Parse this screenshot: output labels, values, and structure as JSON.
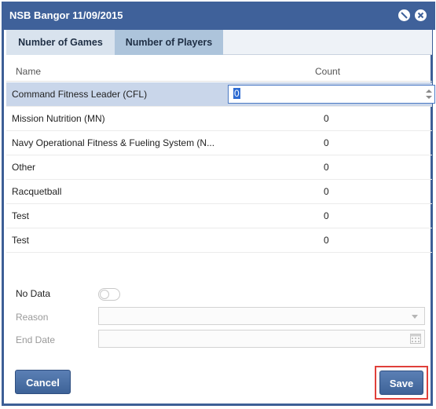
{
  "dialog": {
    "title": "NSB Bangor 11/09/2015"
  },
  "tabs": [
    {
      "label": "Number of Games",
      "active": false
    },
    {
      "label": "Number of Players",
      "active": true
    }
  ],
  "grid": {
    "columns": {
      "name": "Name",
      "count": "Count"
    },
    "rows": [
      {
        "name": "Command Fitness Leader (CFL)",
        "count": "0",
        "selected": true
      },
      {
        "name": "Mission Nutrition (MN)",
        "count": "0"
      },
      {
        "name": "Navy Operational Fitness & Fueling System (N...",
        "count": "0"
      },
      {
        "name": "Other",
        "count": "0"
      },
      {
        "name": "Racquetball",
        "count": "0"
      },
      {
        "name": "Test",
        "count": "0"
      },
      {
        "name": "Test",
        "count": "0"
      }
    ]
  },
  "form": {
    "no_data_label": "No Data",
    "no_data_on": false,
    "reason_label": "Reason",
    "reason_value": "",
    "end_date_label": "End Date",
    "end_date_value": ""
  },
  "buttons": {
    "cancel": "Cancel",
    "save": "Save"
  },
  "colors": {
    "titlebar": "#3f619a",
    "active_tab": "#adc4db",
    "selected_row": "#c9d6ea",
    "highlight_frame": "#e0403a"
  },
  "icons": {
    "minimize": "minimize-icon",
    "close": "close-icon",
    "calendar": "calendar-icon",
    "spinner": "spinner-arrows-icon",
    "dropdown": "chevron-down-icon"
  }
}
